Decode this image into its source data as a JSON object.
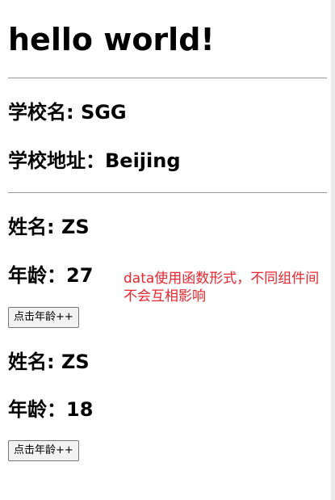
{
  "title": "hello world!",
  "school": {
    "name_label": "学校名: SGG",
    "address_label": "学校地址：Beijing"
  },
  "students": [
    {
      "name_label": "姓名: ZS",
      "age_label": "年龄：27",
      "button_label": "点击年龄++"
    },
    {
      "name_label": "姓名: ZS",
      "age_label": "年龄：18",
      "button_label": "点击年龄++"
    }
  ],
  "annotation": "data使用函数形式，不同组件间不会互相影响",
  "colors": {
    "annotation": "#e8262e",
    "divider": "#999999",
    "button_bg": "#f2f2f2"
  }
}
